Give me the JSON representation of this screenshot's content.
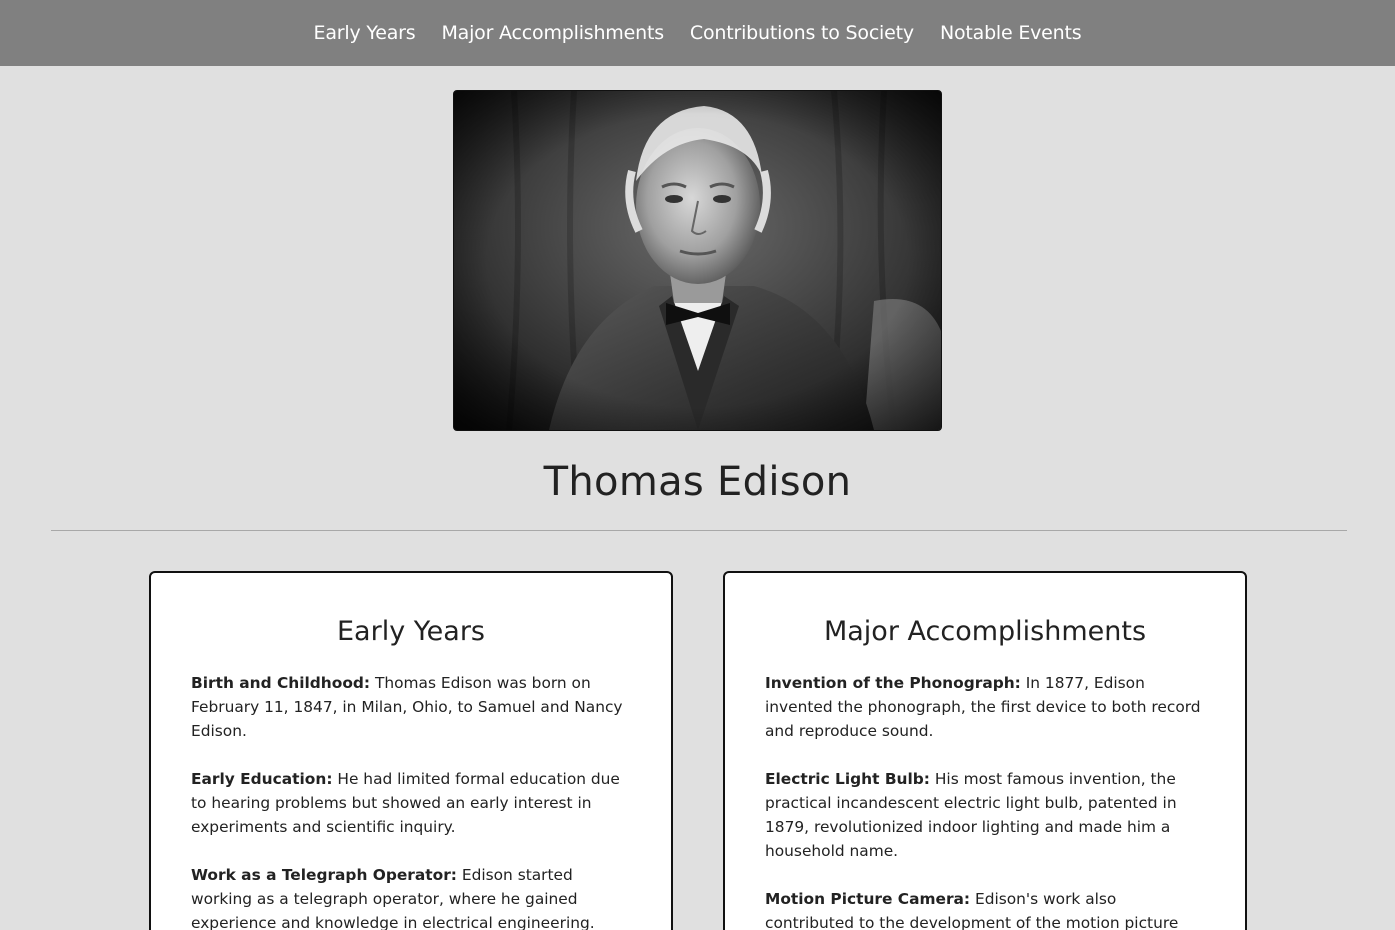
{
  "nav": {
    "items": [
      {
        "label": "Early Years"
      },
      {
        "label": "Major Accomplishments"
      },
      {
        "label": "Contributions to Society"
      },
      {
        "label": "Notable Events"
      }
    ]
  },
  "hero": {
    "image_alt": "Thomas Edison",
    "title": "Thomas Edison"
  },
  "sections": {
    "early_years": {
      "heading": "Early Years",
      "items": [
        {
          "term": "Birth and Childhood:",
          "text": " Thomas Edison was born on February 11, 1847, in Milan, Ohio, to Samuel and Nancy Edison."
        },
        {
          "term": "Early Education:",
          "text": " He had limited formal education due to hearing problems but showed an early interest in experiments and scientific inquiry."
        },
        {
          "term": "Work as a Telegraph Operator:",
          "text": " Edison started working as a telegraph operator, where he gained experience and knowledge in electrical engineering."
        }
      ]
    },
    "accomplishments": {
      "heading": "Major Accomplishments",
      "items": [
        {
          "term": "Invention of the Phonograph:",
          "text": " In 1877, Edison invented the phonograph, the first device to both record and reproduce sound."
        },
        {
          "term": "Electric Light Bulb:",
          "text": " His most famous invention, the practical incandescent electric light bulb, patented in 1879, revolutionized indoor lighting and made him a household name."
        },
        {
          "term": "Motion Picture Camera:",
          "text": " Edison's work also contributed to the development of the motion picture camera, leading to"
        }
      ]
    }
  }
}
